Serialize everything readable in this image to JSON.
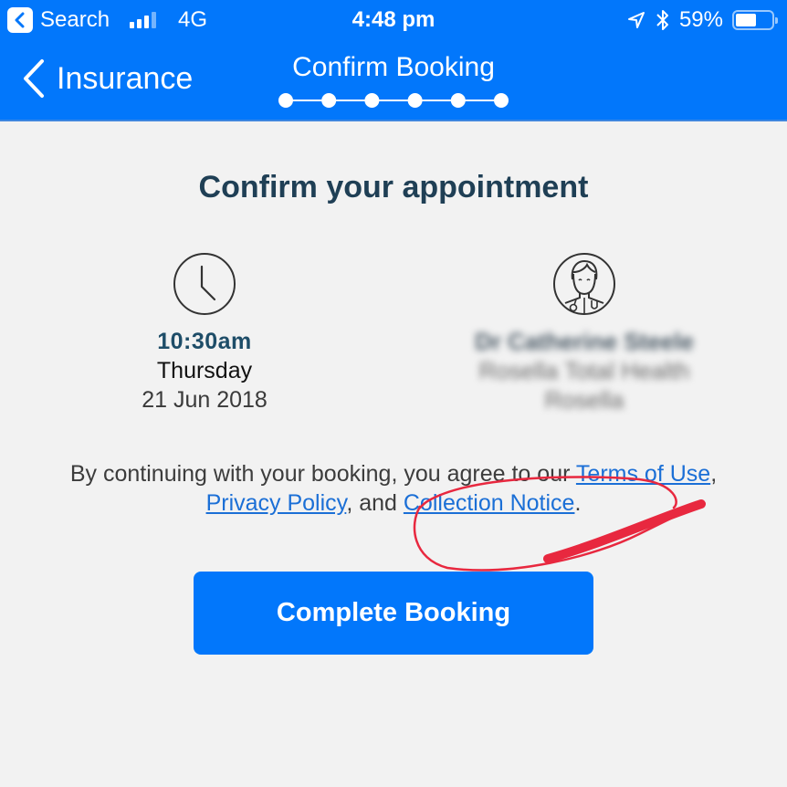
{
  "status_bar": {
    "back_app_label": "Search",
    "network": "4G",
    "time": "4:48 pm",
    "battery_percent_label": "59%",
    "battery_level": 0.59,
    "signal_bars_active": 3,
    "signal_bars_total": 4
  },
  "nav": {
    "back_label": "Insurance",
    "title": "Confirm Booking",
    "steps_total": 6,
    "steps_completed": 6
  },
  "main": {
    "title": "Confirm your appointment",
    "appointment": {
      "time": "10:30am",
      "day": "Thursday",
      "date": "21 Jun 2018"
    },
    "practitioner": {
      "name": "Dr Catherine Steele",
      "clinic": "Rosella Total Health",
      "suburb": "Rosella",
      "redacted": true
    },
    "consent": {
      "prefix": "By continuing with your booking, you agree to our ",
      "terms_link": "Terms of Use",
      "sep1": ", ",
      "privacy_link": "Privacy Policy",
      "sep2": ", and ",
      "collection_link": "Collection Notice",
      "suffix": "."
    },
    "complete_button": "Complete Booking"
  },
  "colors": {
    "brand_blue": "#0277fb",
    "heading": "#1f3f55",
    "link": "#1b6fd6",
    "annotation_red": "#e8283f",
    "background": "#f2f2f2"
  }
}
